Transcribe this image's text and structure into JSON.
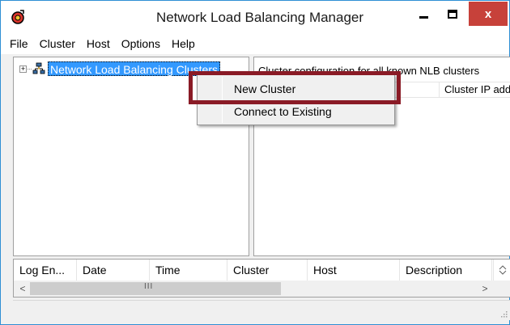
{
  "window": {
    "title": "Network Load Balancing Manager",
    "close_symbol": "x",
    "accent_color": "#2e8fd4",
    "close_color": "#c7413a"
  },
  "menubar": {
    "items": [
      "File",
      "Cluster",
      "Host",
      "Options",
      "Help"
    ]
  },
  "tree": {
    "expander": "+",
    "root_label": "Network Load Balancing Clusters",
    "selection_color": "#3399ff"
  },
  "right_pane": {
    "caption": "Cluster configuration for all known NLB clusters",
    "column": "Cluster IP addr"
  },
  "log": {
    "columns": [
      "Log En...",
      "Date",
      "Time",
      "Cluster",
      "Host",
      "Description"
    ],
    "scroll_left": "<",
    "scroll_right": ">",
    "grip": "III"
  },
  "context_menu": {
    "items": [
      "New Cluster",
      "Connect to Existing"
    ],
    "highlighted_item": "New Cluster",
    "highlight_color": "#8a1b26"
  },
  "icons": {
    "app": "nlb-app-icon",
    "tree": "cluster-group-icon"
  }
}
